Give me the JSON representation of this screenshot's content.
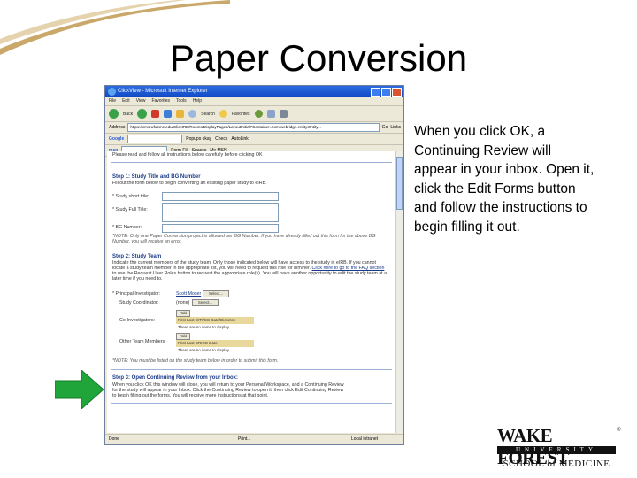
{
  "slide": {
    "title": "Paper Conversion",
    "description": "When you click OK, a Continuing Review will appear in your inbox. Open it, click the Edit Forms button and follow the instructions to begin filling it out.",
    "logo": {
      "line1": "WAKE FOREST",
      "line2": "UNIVERSITY",
      "line3": "SCHOOL of MEDICINE",
      "reg": "®"
    }
  },
  "browser": {
    "window_title": "ClickView - Microsoft Internet Explorer",
    "menu": [
      "File",
      "Edit",
      "View",
      "Favorites",
      "Tools",
      "Help"
    ],
    "toolbar": {
      "back": "Back",
      "search": "Search",
      "favorites": "Favorites"
    },
    "address_label": "Address",
    "address_value": "https://cms.wfubmc.edu/ClickIRB/Rooms/DisplayPages/LayoutInitial?Container=com.webridge.entity.Entity...",
    "go_label": "Go",
    "links_label": "Links",
    "google_label": "Google",
    "popups_label": "Popups okay",
    "check_label": "Check",
    "autolink_label": "AutoLink",
    "msn_label": "msn",
    "form_fill_label": "Form Fill",
    "spaces_label": "Spaces",
    "mymsn_label": "My MSN",
    "status_left": "Done",
    "status_print": "Print...",
    "status_right": "Local intranet"
  },
  "form": {
    "intro": "Please read and follow all instructions below carefully before clicking OK",
    "step1_title": "Step 1: Study Title and BG Number",
    "step1_instr": "Fill out the form below to begin converting an existing paper study to eIRB.",
    "short_title_label": "* Study short title:",
    "full_title_label": "* Study Full Title:",
    "bg_label": "* BG Number:",
    "step1_note": "*NOTE: Only one Paper Conversion project is allowed per BG Number. If you have already filled out this form for the above BG Number, you will receive an error.",
    "step2_title": "Step 2: Study Team",
    "step2_text": "Indicate the current members of the study team. Only those indicated below will have access to the study in eIRB. If you cannot locate a study team member in the appropriate list, you will need to request this role for him/her.",
    "step2_link": "Click here to go to the FAQ section",
    "step2_text2": "to use the Request User Roles button to request the appropriate role(s). You will have another opportunity to edit the study team at a later time if you need to.",
    "pi_label": "* Principal Investigator:",
    "pi_value": "Scott Moser",
    "select_label": "Select...",
    "coordinator_label": "Study Coordinator:",
    "coordinator_value": "(none)",
    "co_inv_label": "Co-Investigators:",
    "add_label": "Add",
    "co_inv_headers": "First Last  CITI/CC Date/Dicketch",
    "co_inv_empty": "There are no items to display",
    "other_label": "Other Team Members",
    "other_headers": "First   Last   CRICC Date",
    "other_empty": "There are no items to display",
    "step2_note": "*NOTE: You must be listed on the study team below in order to submit this form.",
    "step3_title": "Step 3: Open Continuing Review from your Inbox:",
    "step3_text1": "When you click OK this window will close, you will return to your Personal Workspace, and a Continuing Review",
    "step3_text2": "for the study will appear in your Inbox. Click the Continuing Review to open it, then click Edit Continuing Review",
    "step3_text3": "to begin filling out the forms. You will receive more instructions at that point."
  },
  "colors": {
    "arrow": "#1fa53a",
    "swoosh": "#c9a86a",
    "link": "#1a3a8a"
  }
}
